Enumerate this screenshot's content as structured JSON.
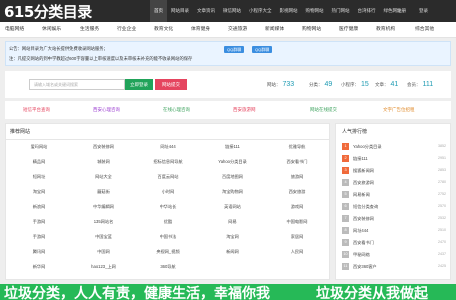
{
  "header": {
    "logo": "615分类目录",
    "nav": [
      "首页",
      "网站目录",
      "文章资讯",
      "微信网站",
      "小程序大全",
      "影视网站",
      "购物网站",
      "热门网站",
      "台湾排行",
      "绿色网站"
    ],
    "login": "注册",
    "register": "登录"
  },
  "categories": [
    "电脑网络",
    "休闲娱乐",
    "生活服务",
    "行业企业",
    "教育文化",
    "体育健身",
    "交通旅游",
    "新闻媒体",
    "购物网站",
    "医疗健康",
    "教育机构",
    "综合其他"
  ],
  "notice": {
    "line1": "公告：网站目录为广大站长提供免费收录网站服务；",
    "line2": "注：凡提交网站的到中学教超过600字容量以上审核速度以及未审核未补充的能不收录网站的保存",
    "qq1": "QQ群聊",
    "qq2": "QQ群聊"
  },
  "search": {
    "placeholder": "请输入域名或关键词搜索",
    "submit_label": "立即登录",
    "submit2_label": "网站提交"
  },
  "stats": [
    {
      "label": "网站：",
      "value": "733"
    },
    {
      "label": "分类：",
      "value": "49"
    },
    {
      "label": "小程序：",
      "value": "15"
    },
    {
      "label": "文章：",
      "value": "41"
    },
    {
      "label": "会员：",
      "value": "111"
    }
  ],
  "ad_links": [
    {
      "text": "短信平台查询",
      "color": "#e5455f"
    },
    {
      "text": "西安心理咨询",
      "color": "#9c3fd1"
    },
    {
      "text": "在线心理咨询",
      "color": "#3fa35f"
    },
    {
      "text": "西安旅游网",
      "color": "#e5455f"
    },
    {
      "text": "网站在线提交",
      "color": "#3fa35f"
    },
    {
      "text": "文字广告位招租",
      "color": "#e08a2a"
    }
  ],
  "recommend": {
    "title": "推荐网站",
    "rows": [
      [
        "爱玛网站",
        "西安装修网",
        "网址444",
        "链接111",
        "优雅导航"
      ],
      [
        "精品网",
        "城装网",
        "招标信息网导航",
        "Yahoo分类目录",
        "西安看书门"
      ],
      [
        "短网址",
        "网站大全",
        "百度云网站",
        "百度地图网",
        "旅游网"
      ],
      [
        "淘宝网",
        "蘑菇街",
        "小时网",
        "淘宝购物网",
        "西安旅游"
      ],
      [
        "新浪网",
        "中华编辑网",
        "中华站长",
        "英语网站",
        "游戏网"
      ],
      [
        "手游网",
        "135网站名",
        "优酷",
        "网易",
        "中国电影网"
      ],
      [
        "手游网",
        "中国宝蓝",
        "中国书法",
        "淘宝网",
        "家居网"
      ],
      [
        "腾讯网",
        "中国网",
        "央视网_视频",
        "新闻网",
        "人民网"
      ],
      [
        "新华网",
        "hao123_上网",
        "360导航",
        "",
        ""
      ]
    ]
  },
  "ranking": {
    "title": "人气排行榜",
    "items": [
      {
        "num": "1",
        "name": "Yahoo分类目录",
        "count": "3852"
      },
      {
        "num": "2",
        "name": "链接111",
        "count": "2951"
      },
      {
        "num": "3",
        "name": "搜狐新闻网",
        "count": "2853"
      },
      {
        "num": "4",
        "name": "西安旅游网",
        "count": "2780"
      },
      {
        "num": "5",
        "name": "网易新闻",
        "count": "2752"
      },
      {
        "num": "6",
        "name": "短信分类查询",
        "count": "2570"
      },
      {
        "num": "7",
        "name": "西安装修网",
        "count": "2532"
      },
      {
        "num": "8",
        "name": "网址444",
        "count": "2510"
      },
      {
        "num": "9",
        "name": "西安看书门",
        "count": "2470"
      },
      {
        "num": "10",
        "name": "甲秘网络",
        "count": "2437"
      },
      {
        "num": "11",
        "name": "西安360客户",
        "count": "2425"
      }
    ]
  },
  "banner": {
    "left": "垃圾分类，人人有责，健康生活，幸福你我",
    "right": "垃圾分类从我做起"
  }
}
